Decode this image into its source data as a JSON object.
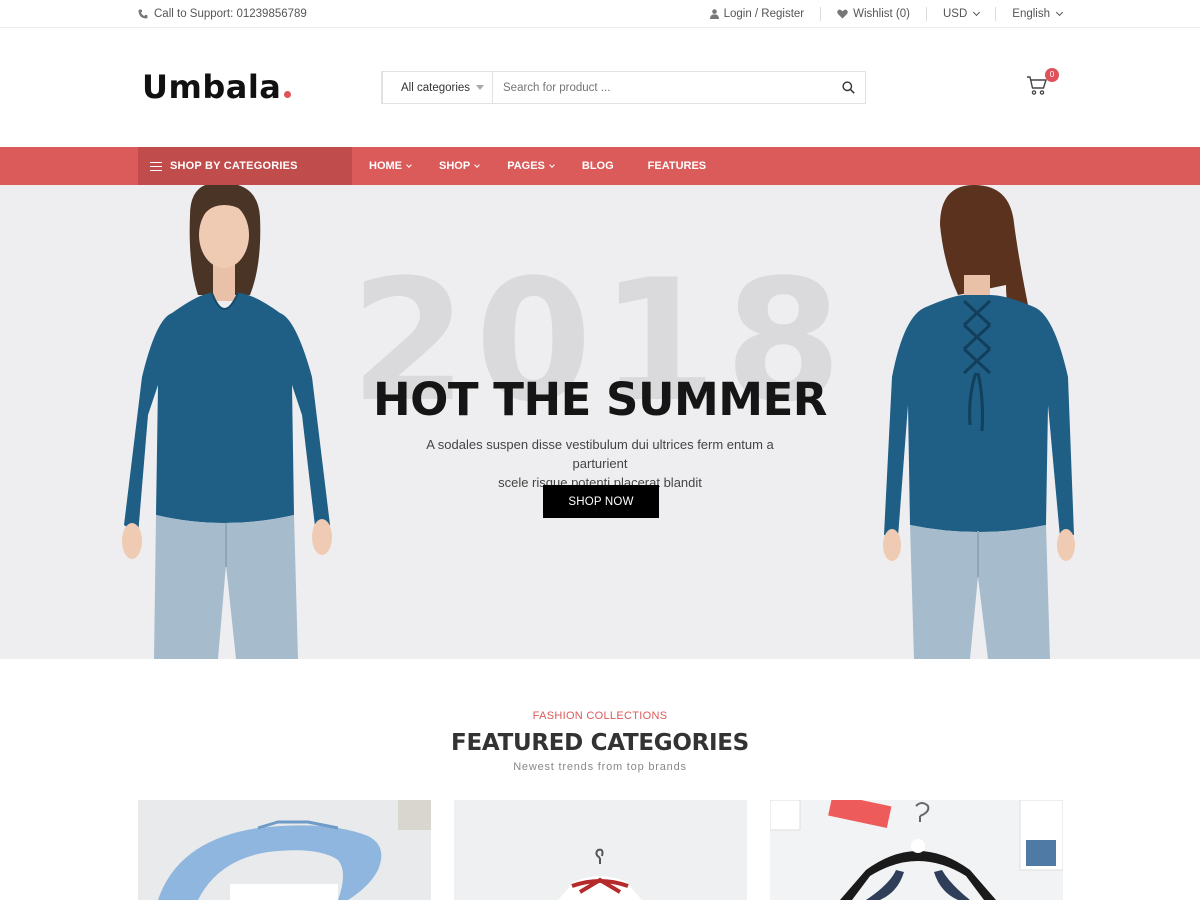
{
  "topbar": {
    "support": "Call to Support: 01239856789",
    "login": "Login / Register",
    "wishlist": "Wishlist (0)",
    "currency": "USD",
    "language": "English"
  },
  "header": {
    "logo": "Umbala",
    "category_select": "All categories",
    "search_placeholder": "Search for product ...",
    "cart_count": "0"
  },
  "nav": {
    "shop_by_categories": "SHOP BY CATEGORIES",
    "items": [
      {
        "label": "HOME"
      },
      {
        "label": "SHOP"
      },
      {
        "label": "PAGES"
      },
      {
        "label": "BLOG"
      },
      {
        "label": "FEATURES"
      }
    ]
  },
  "hero": {
    "year": "2018",
    "title": "HOT THE SUMMER",
    "subtitle_line1": "A sodales suspen disse vestibulum dui ultrices ferm entum a parturient",
    "subtitle_line2": "scele risque potenti placerat blandit",
    "button": "SHOP NOW"
  },
  "featured": {
    "kicker": "FASHION COLLECTIONS",
    "title": "FEATURED CATEGORIES",
    "subtitle": "Newest trends from top brands"
  },
  "colors": {
    "accent": "#db5b5b",
    "accent_dark": "#c04c4c",
    "shirt": "#1f5f85",
    "jeans": "#a6bccd"
  }
}
